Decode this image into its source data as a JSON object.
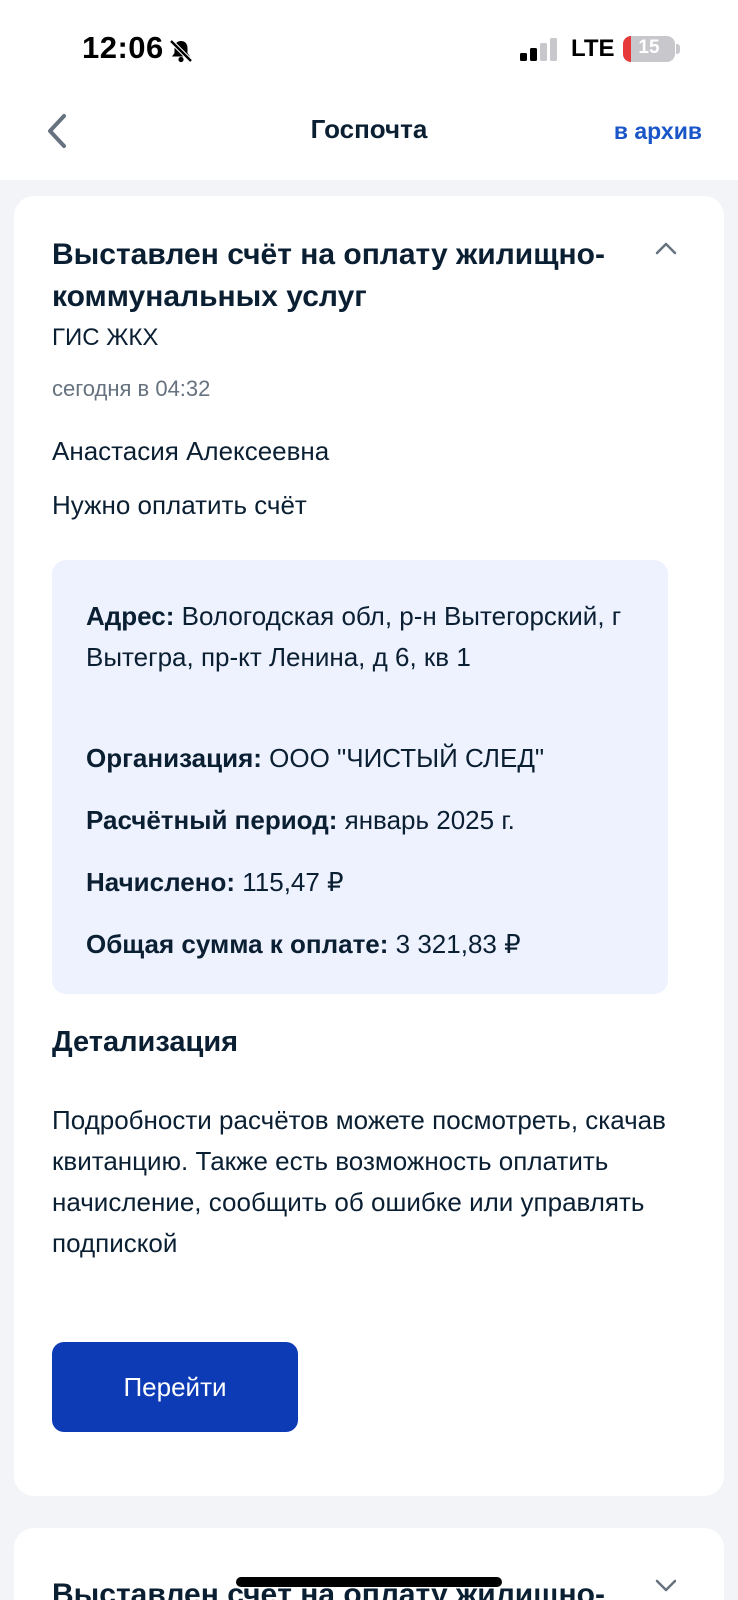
{
  "status_bar": {
    "time": "12:06",
    "network": "LTE",
    "battery_level": "15",
    "battery_fraction": 0.15,
    "icons": [
      "bell-slash-icon",
      "signal-icon",
      "battery-icon"
    ]
  },
  "nav": {
    "title": "Госпочта",
    "action_label": "в архив",
    "back_icon": "chevron-left-icon"
  },
  "notification": {
    "title": "Выставлен счёт на оплату жилищно-коммунальных услуг",
    "source": "ГИС ЖКХ",
    "date": "сегодня в 04:32",
    "recipient": "Анастасия Алексеевна",
    "message": "Нужно оплатить счёт",
    "details": {
      "address_label": "Адрес:",
      "address_value": " Вологодская обл, р-н Вытегорский, г Вытегра, пр-кт Ленина, д 6, кв 1",
      "organization_label": "Организация:",
      "organization_value": " ООО \"ЧИСТЫЙ СЛЕД\"",
      "period_label": "Расчётный период:",
      "period_value": " январь 2025 г.",
      "charged_label": "Начислено:",
      "charged_value": " 115,47 ₽",
      "total_label": "Общая сумма к оплате:",
      "total_value": " 3 321,83 ₽"
    },
    "section_title": "Детализация",
    "section_text": "Подробности расчётов можете посмотреть, скачав квитанцию. Также есть возможность оплатить начисление, сообщить об ошибке или управлять подпиской",
    "button_label": "Перейти"
  },
  "next_notification": {
    "title": "Выставлен счёт на оплату жилищно-"
  },
  "colors": {
    "accent": "#1a56c8",
    "button": "#0d3bb5",
    "info_bg": "#edf2fe",
    "text": "#0b1f33",
    "muted": "#66727f",
    "battery_low": "#e8393a"
  }
}
